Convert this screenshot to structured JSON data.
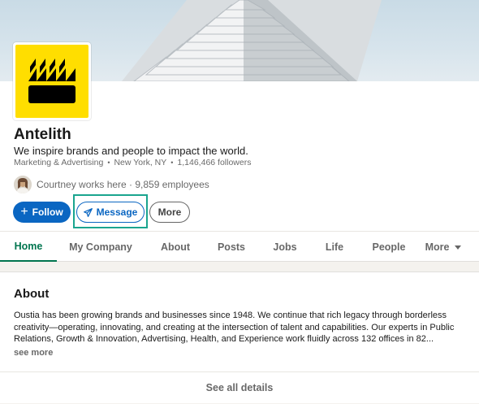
{
  "company": {
    "name": "Antelith",
    "tagline": "We inspire brands and people to impact the world.",
    "industry": "Marketing & Advertising",
    "location": "New York, NY",
    "followers": "1,146,466 followers",
    "employees_text": "Courtney works here · 9,859 employees",
    "logo_icon": "factory-icon",
    "logo_color": "#ffde00"
  },
  "actions": {
    "follow_label": "Follow",
    "follow_icon": "plus-icon",
    "message_label": "Message",
    "message_icon": "send-icon",
    "more_label": "More"
  },
  "tabs": [
    {
      "label": "Home",
      "active": true
    },
    {
      "label": "My Company"
    },
    {
      "label": "About"
    },
    {
      "label": "Posts"
    },
    {
      "label": "Jobs"
    },
    {
      "label": "Life"
    },
    {
      "label": "People"
    },
    {
      "label": "More"
    }
  ],
  "about": {
    "title": "About",
    "body": "Oustia has been growing brands and businesses since 1948. We continue that rich legacy through borderless creativity—operating, innovating, and creating at the intersection of talent and capabilities. Our experts in Public Relations, Growth & Innovation, Advertising, Health, and Experience work fluidly across 132 offices in 82...",
    "see_more": "see more",
    "see_all": "See all details"
  },
  "colors": {
    "primary": "#0a66c2",
    "active_tab": "#01754f",
    "highlight": "#1aa58f"
  }
}
